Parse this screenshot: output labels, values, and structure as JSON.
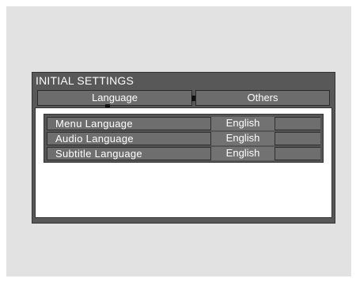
{
  "dialog": {
    "title": "INITIAL SETTINGS"
  },
  "tabs": [
    {
      "label": "Language",
      "selected": true
    },
    {
      "label": "Others",
      "selected": false
    }
  ],
  "settings": [
    {
      "label": "Menu Language",
      "value": "English"
    },
    {
      "label": "Audio Language",
      "value": "English"
    },
    {
      "label": "Subtitle Language",
      "value": "English"
    }
  ]
}
